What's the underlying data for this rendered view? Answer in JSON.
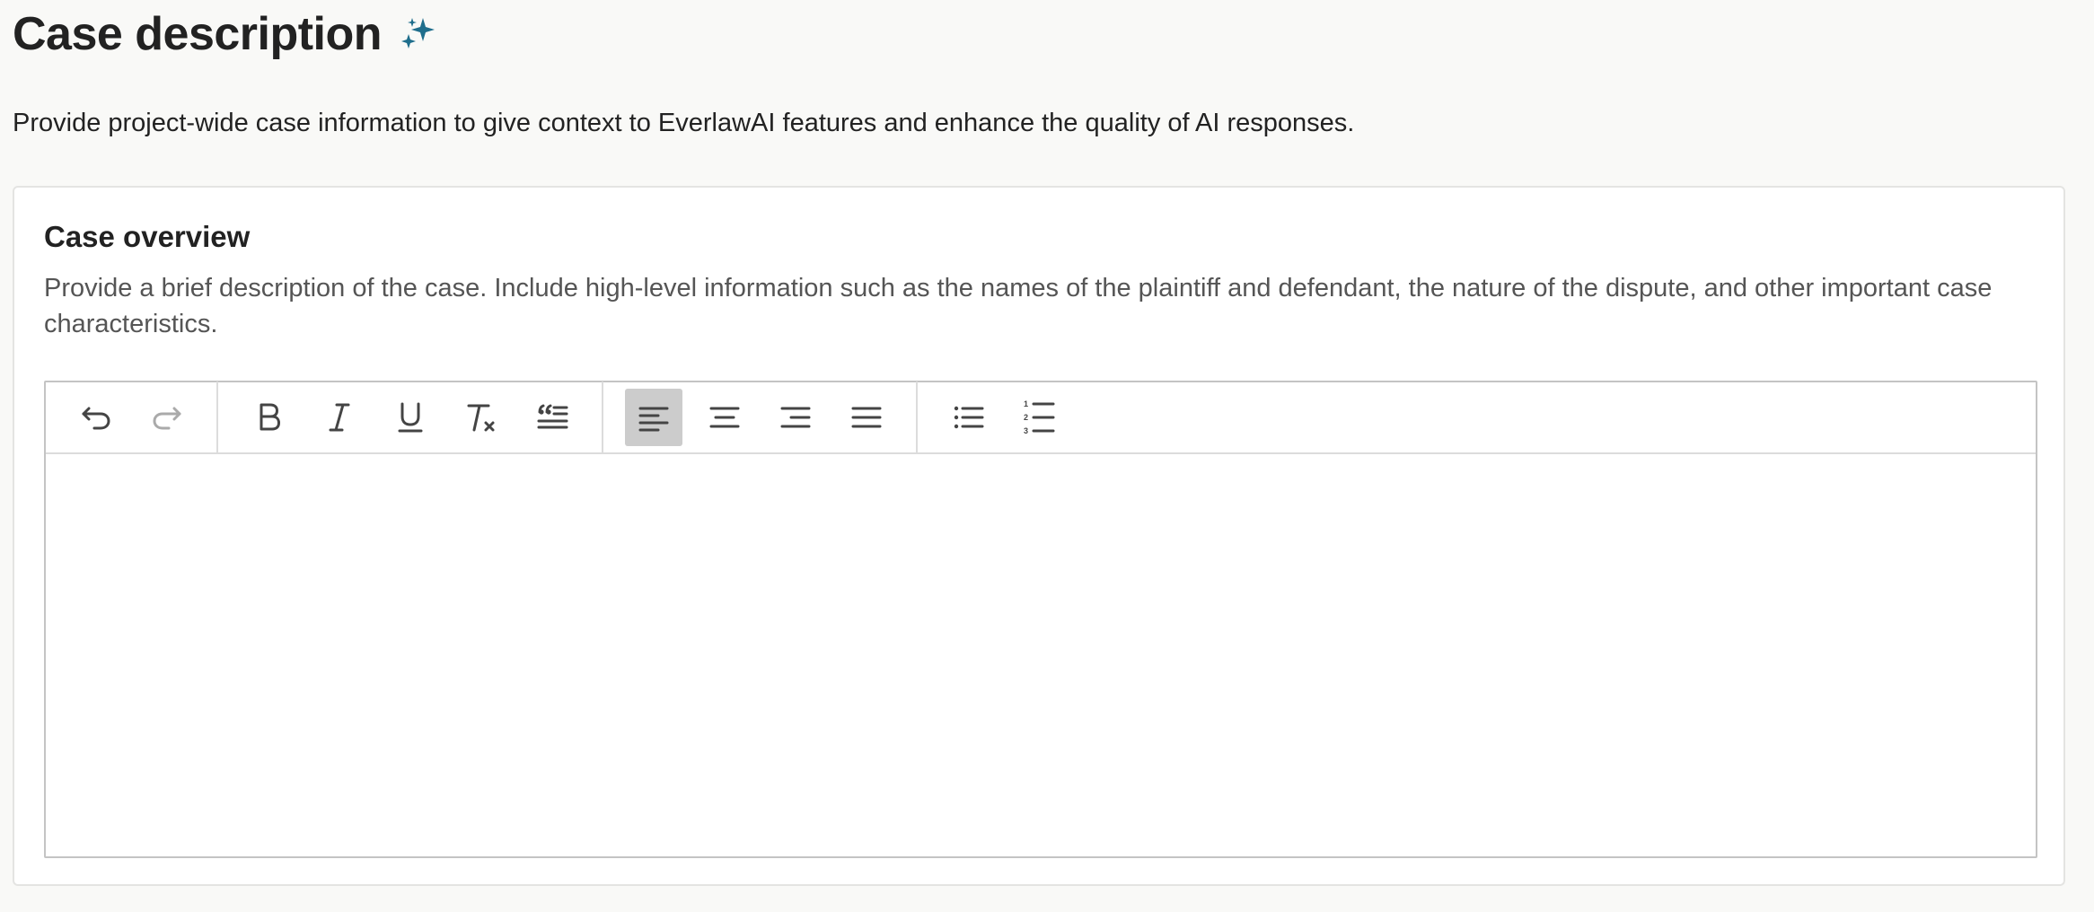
{
  "header": {
    "title": "Case description",
    "title_icon": "sparkle-icon",
    "accent_color": "#1f6e8c",
    "intro": "Provide project-wide case information to give context to EverlawAI features and enhance the quality of AI responses."
  },
  "card": {
    "title": "Case overview",
    "description": "Provide a brief description of the case. Include high-level information such as the names of the plaintiff and defendant, the nature of the dispute, and other important case characteristics.",
    "editor": {
      "content": "",
      "toolbar": {
        "history": [
          {
            "icon": "undo-icon",
            "enabled": true
          },
          {
            "icon": "redo-icon",
            "enabled": false
          }
        ],
        "formatting": [
          {
            "icon": "bold-icon"
          },
          {
            "icon": "italic-icon"
          },
          {
            "icon": "underline-icon"
          },
          {
            "icon": "clear-formatting-icon"
          },
          {
            "icon": "blockquote-icon"
          }
        ],
        "alignment": [
          {
            "icon": "align-left-icon",
            "active": true
          },
          {
            "icon": "align-center-icon",
            "active": false
          },
          {
            "icon": "align-right-icon",
            "active": false
          },
          {
            "icon": "align-justify-icon",
            "active": false
          }
        ],
        "lists": [
          {
            "icon": "bulleted-list-icon"
          },
          {
            "icon": "numbered-list-icon",
            "labels": [
              "1",
              "2",
              "3"
            ]
          }
        ]
      }
    }
  }
}
